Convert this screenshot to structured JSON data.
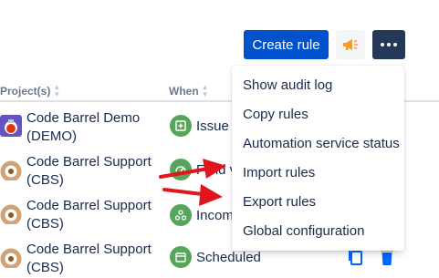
{
  "toolbar": {
    "create_label": "Create rule",
    "feedback_icon": "megaphone-icon",
    "more_icon": "more-icon"
  },
  "table": {
    "headers": {
      "project": "Project(s)",
      "when": "When"
    },
    "rows": [
      {
        "project": "Code Barrel Demo (DEMO)",
        "when": "Issue c",
        "avatar": "demo-avatar",
        "when_icon": "issue-created-icon"
      },
      {
        "project": "Code Barrel Support (CBS)",
        "when": "Field v",
        "avatar": "cbs-avatar",
        "when_icon": "field-value-icon"
      },
      {
        "project": "Code Barrel Support (CBS)",
        "when": "Incom",
        "avatar": "cbs-avatar",
        "when_icon": "incoming-webhook-icon"
      },
      {
        "project": "Code Barrel Support (CBS)",
        "when": "Scheduled",
        "avatar": "cbs-avatar",
        "when_icon": "scheduled-icon"
      }
    ]
  },
  "menu": {
    "items": [
      "Show audit log",
      "Copy rules",
      "Automation service status",
      "Import rules",
      "Export rules",
      "Global configuration"
    ]
  },
  "colors": {
    "primary": "#0052cc",
    "more_bg": "#253858",
    "trigger_green": "#57a55a",
    "action_blue": "#0065ff",
    "annotation_red": "#e0161c",
    "megaphone": "#ff991f"
  }
}
